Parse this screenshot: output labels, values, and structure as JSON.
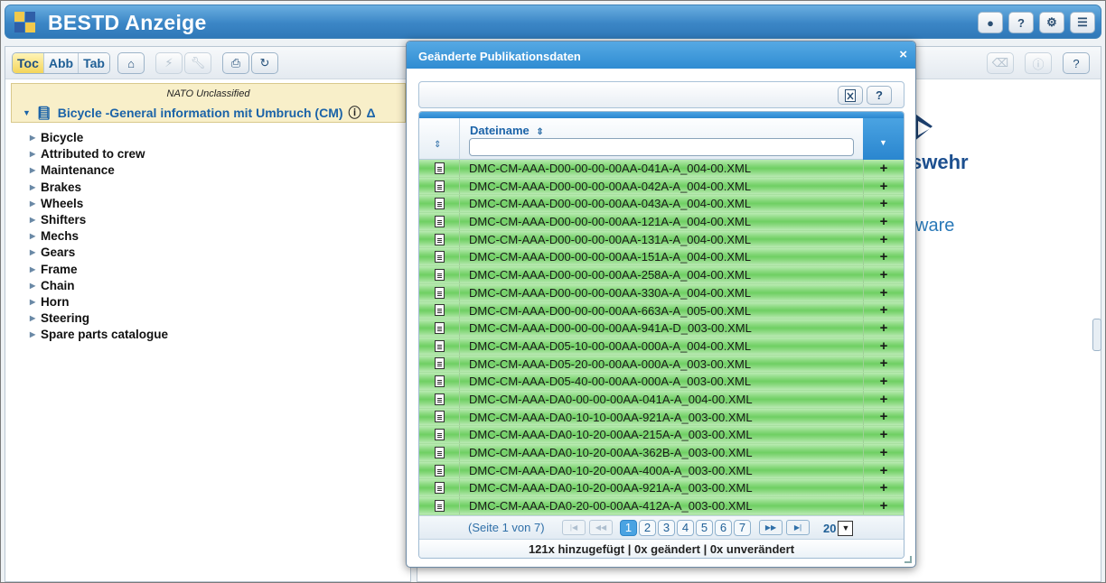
{
  "app": {
    "title": "BESTD Anzeige"
  },
  "header_buttons": [
    {
      "name": "user-icon",
      "glyph": "👤"
    },
    {
      "name": "help-icon",
      "glyph": "?"
    },
    {
      "name": "gear-icon",
      "glyph": "⚙"
    },
    {
      "name": "menu-icon",
      "glyph": "☰"
    }
  ],
  "left_toolbar": {
    "tabs": [
      "Toc",
      "Abb",
      "Tab"
    ],
    "active_tab": "Toc"
  },
  "document": {
    "classification": "NATO Unclassified",
    "title": "Bicycle -General information mit Umbruch (CM)",
    "delta_symbol": "Δ"
  },
  "toc": [
    "Bicycle",
    "Attributed to crew",
    "Maintenance",
    "Brakes",
    "Wheels",
    "Shifters",
    "Mechs",
    "Gears",
    "Frame",
    "Chain",
    "Horn",
    "Steering",
    "Spare parts catalogue"
  ],
  "right_panel": {
    "brand_fragment": "swehr",
    "software_fragment": "ware",
    "help_label": "?"
  },
  "dialog": {
    "title": "Geänderte Publikationsdaten",
    "close_glyph": "×",
    "toolbar_help": "?",
    "column_header": "Dateiname",
    "filter_value": "",
    "add_glyph": "+",
    "rows": [
      "DMC-CM-AAA-D00-00-00-00AA-041A-A_004-00.XML",
      "DMC-CM-AAA-D00-00-00-00AA-042A-A_004-00.XML",
      "DMC-CM-AAA-D00-00-00-00AA-043A-A_004-00.XML",
      "DMC-CM-AAA-D00-00-00-00AA-121A-A_004-00.XML",
      "DMC-CM-AAA-D00-00-00-00AA-131A-A_004-00.XML",
      "DMC-CM-AAA-D00-00-00-00AA-151A-A_004-00.XML",
      "DMC-CM-AAA-D00-00-00-00AA-258A-A_004-00.XML",
      "DMC-CM-AAA-D00-00-00-00AA-330A-A_004-00.XML",
      "DMC-CM-AAA-D00-00-00-00AA-663A-A_005-00.XML",
      "DMC-CM-AAA-D00-00-00-00AA-941A-D_003-00.XML",
      "DMC-CM-AAA-D05-10-00-00AA-000A-A_004-00.XML",
      "DMC-CM-AAA-D05-20-00-00AA-000A-A_003-00.XML",
      "DMC-CM-AAA-D05-40-00-00AA-000A-A_003-00.XML",
      "DMC-CM-AAA-DA0-00-00-00AA-041A-A_004-00.XML",
      "DMC-CM-AAA-DA0-10-10-00AA-921A-A_003-00.XML",
      "DMC-CM-AAA-DA0-10-20-00AA-215A-A_003-00.XML",
      "DMC-CM-AAA-DA0-10-20-00AA-362B-A_003-00.XML",
      "DMC-CM-AAA-DA0-10-20-00AA-400A-A_003-00.XML",
      "DMC-CM-AAA-DA0-10-20-00AA-921A-A_003-00.XML",
      "DMC-CM-AAA-DA0-20-00-00AA-412A-A_003-00.XML"
    ],
    "pager": {
      "info": "(Seite 1 von 7)",
      "pages": [
        "1",
        "2",
        "3",
        "4",
        "5",
        "6",
        "7"
      ],
      "current_page": "1",
      "page_size": "20"
    },
    "summary": "121x hinzugefügt | 0x geändert | 0x unverändert"
  },
  "colors": {
    "header_blue": "#3b86c6",
    "row_green": "#6fcf63",
    "title_blue": "#1b63a8",
    "doc_header_bg": "#f8efc9"
  }
}
